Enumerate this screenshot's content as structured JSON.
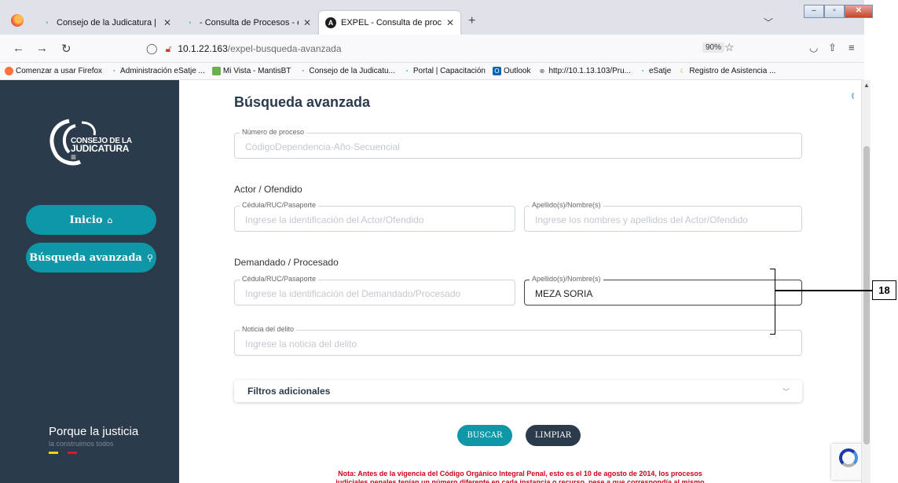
{
  "browser": {
    "tabs": [
      {
        "title": "Consejo de la Judicatura | Cons",
        "active": false
      },
      {
        "title": "- Consulta de Procesos - eSATJE",
        "active": false
      },
      {
        "title": "EXPEL - Consulta de procesos",
        "active": true
      }
    ],
    "new_tab": "+",
    "tab_close": "✕",
    "url_host": "10.1.22.163",
    "url_path": "/expel-busqueda-avanzada",
    "zoom": "90%",
    "bookmarks": [
      "Comenzar a usar Firefox",
      "Administración eSatje ...",
      "Mi Vista - MantisBT",
      "Consejo de la Judicatu...",
      "Portal | Capacitación",
      "Outlook",
      "http://10.1.13.103/Pru...",
      "eSatje",
      "Registro de Asistencia ..."
    ]
  },
  "sidebar": {
    "logo_line1": "CONSEJO DE LA",
    "logo_line2": "JUDICATURA",
    "nav": [
      {
        "label": "Inicio",
        "icon": "home-icon"
      },
      {
        "label": "Búsqueda avanzada",
        "icon": "search-icon"
      }
    ],
    "tagline": "Porque la justicia",
    "tagline_sub": "la construimos todos",
    "flag_colors": [
      "#f2d500",
      "#2b3b4c",
      "#e0142c"
    ]
  },
  "main": {
    "title": "Búsqueda avanzada",
    "numero_proceso": {
      "label": "Número de proceso",
      "placeholder": "CódigoDependencia-Año-Secuencial"
    },
    "actor_section": "Actor / Ofendido",
    "actor_id": {
      "label": "Cédula/RUC/Pasaporte",
      "placeholder": "Ingrese la identificación del Actor/Ofendido"
    },
    "actor_name": {
      "label": "Apellido(s)/Nombre(s)",
      "placeholder": "Ingrese los nombres y apellidos del Actor/Ofendido"
    },
    "demandado_section": "Demandado / Procesado",
    "demandado_id": {
      "label": "Cédula/RUC/Pasaporte",
      "placeholder": "Ingrese la identificación del Demandado/Procesado"
    },
    "demandado_name": {
      "label": "Apellido(s)/Nombre(s)",
      "value": "MEZA SORIA"
    },
    "noticia": {
      "label": "Noticia del delito",
      "placeholder": "Ingrese la noticia del delito"
    },
    "filters_title": "Filtros adicionales",
    "buscar": "BUSCAR",
    "limpiar": "LIMPIAR",
    "note": "Nota: Antes de la vigencia del Código Orgánico Integral Penal, esto es el 10 de agosto de 2014, los procesos judiciales penales tenían un número diferente en cada instancia o recurso, pese a que correspondía al mismo expediente."
  },
  "annotation": {
    "number": "18"
  },
  "colors": {
    "sidebar": "#2b3b4c",
    "accent": "#0d97a7",
    "note": "#d0021b"
  }
}
